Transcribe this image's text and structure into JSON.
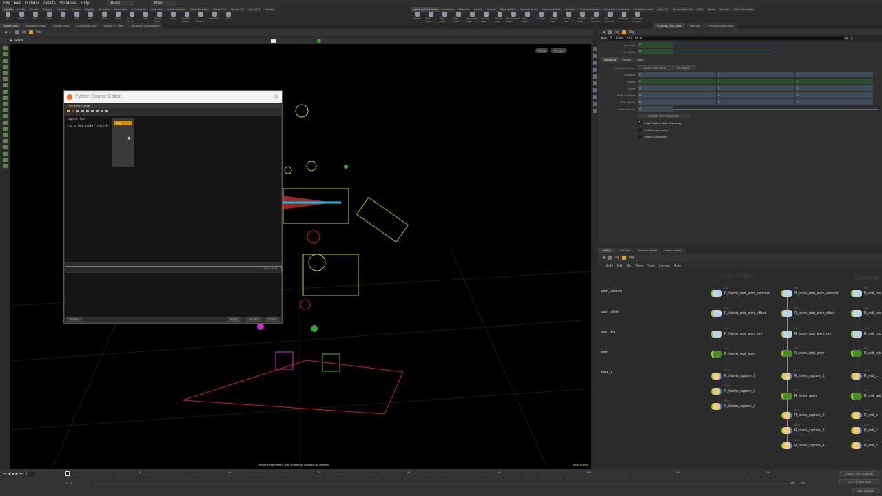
{
  "menu": {
    "items": [
      "File",
      "Edit",
      "Render",
      "Assets",
      "Windows",
      "Help"
    ],
    "desktop": "Build",
    "context": "Main"
  },
  "shelf_left": {
    "tabs": [
      "Create",
      "Modify",
      "Model",
      "Polygon",
      "Deform",
      "Texture",
      "Rigging",
      "Muscles",
      "Characters",
      "Constraints",
      "Hair Utils",
      "Guide Process",
      "Guide Brushes",
      "Terrain FX",
      "Simple FX",
      "Cloud FX",
      "Volume"
    ],
    "tools": [
      "Box",
      "Sphere",
      "Tube",
      "Torus",
      "Grid",
      "Null",
      "Line",
      "Circle",
      "Curve",
      "Draw Curve",
      "Path",
      "Spray Paint",
      "Font",
      "Platonic Solids",
      "L-System",
      "Metaball",
      "File"
    ]
  },
  "shelf_right": {
    "tabs": [
      "Lights and Cameras",
      "Collisions",
      "Particles",
      "Grains",
      "Vellum",
      "Rigid Bodies",
      "Particle Fluids",
      "Viscous Fluids",
      "Oceans",
      "Fluid Containers",
      "Populate Containers",
      "Container Tools",
      "Pyro FX",
      "Sparse Pyro FX",
      "FEM",
      "Wires",
      "Crowds",
      "Drive Simulation"
    ],
    "tools": [
      "Camera",
      "Point Light",
      "Spot Light",
      "Area Light",
      "Geometry Light",
      "Volume Light",
      "Distant Light",
      "Environment Light",
      "Sky Light",
      "GI Light",
      "Caustic Light",
      "Portal Light",
      "Ambient Light",
      "Stereo Camera",
      "VR Camera",
      "Switcher",
      "Gamepad Camera"
    ]
  },
  "pane_tabs_left": [
    "Scene View",
    "Animation Editor",
    "Render View",
    "Composite View",
    "Motion FX View",
    "Geometry Spreadsheet"
  ],
  "pane_tabs_right": [
    "R_thumb_root_anim",
    "Take List",
    "Performance Monitor"
  ],
  "path": {
    "root": "obj",
    "node": "Rig"
  },
  "viewport": {
    "tool": "Select",
    "persp": "Persp",
    "cam": "No cam",
    "status": "Select the geometry, then choose an operation to perform.",
    "edition": "Indie Edition"
  },
  "pse": {
    "title": "Python Source Editor",
    "module": "hou.session module",
    "code_line1": "import hou",
    "code_line2": "rig = hou.node(\"/obj/R",
    "popup_item": "Rig",
    "cursor_pos": "Ln 3, Col 23",
    "buttons": {
      "reload": "Reload",
      "apply": "Apply",
      "accept": "Accept",
      "close": "Close"
    }
  },
  "params": {
    "node_type": "Null",
    "node_name": "R_thumb_root_anim",
    "bend": [
      {
        "label": "Bend Mid",
        "value": "0"
      },
      {
        "label": "Bend End",
        "value": "0"
      }
    ],
    "tabs": [
      "Transform",
      "Render",
      "Misc"
    ],
    "transform_order_label": "Transform Order",
    "transform_order": "Scale Rot Trans",
    "rotate_order": "Rx Ry Rz",
    "rows": [
      {
        "label": "Translate",
        "values": [
          "0",
          "0",
          "0"
        ]
      },
      {
        "label": "Rotate",
        "values": [
          "0",
          "0",
          "0"
        ]
      },
      {
        "label": "Scale",
        "values": [
          "1",
          "1",
          "1"
        ]
      },
      {
        "label": "Pivot Translate",
        "values": [
          "0",
          "0",
          "0"
        ]
      },
      {
        "label": "Pivot Rotate",
        "values": [
          "0",
          "0",
          "0"
        ]
      }
    ],
    "uniform_scale_label": "Uniform Scale",
    "uniform_scale": "1",
    "modify_pre": "Modify Pre-Transform",
    "checks": [
      {
        "label": "Keep Position When Parenting",
        "checked": true
      },
      {
        "label": "Child Compensation",
        "checked": false
      },
      {
        "label": "Enable Constraints",
        "checked": false
      }
    ]
  },
  "network": {
    "tabs": [
      "/obj/Rig",
      "Tree View",
      "Material Palette",
      "Asset Browser"
    ],
    "menu": [
      "Add",
      "Edit",
      "Go",
      "View",
      "Tools",
      "Layout",
      "Help"
    ],
    "watermark1": "Indie Edition",
    "watermark2": "Objects",
    "left_labels": [
      "anim_connect",
      "anim_offset",
      "anim_drv",
      "anim",
      "bone_1"
    ],
    "thumb": [
      {
        "t": "Null",
        "n": "R_thumb_root_anim_connect"
      },
      {
        "t": "Null",
        "n": "R_thumb_root_anim_offset"
      },
      {
        "t": "Null",
        "n": "R_thumb_root_anim_drv"
      },
      {
        "t": "Null",
        "n": "R_thumb_root_anim"
      },
      {
        "t": "Bone",
        "n": "R_thumb_capture_1"
      },
      {
        "t": "Bone",
        "n": "R_thumb_capture_2"
      },
      {
        "t": "Bone",
        "n": "R_thumb_capture_3"
      }
    ],
    "index": [
      {
        "t": "Null",
        "n": "R_index_root_anim_connect"
      },
      {
        "t": "Null",
        "n": "R_index_root_anim_offset"
      },
      {
        "t": "Null",
        "n": "R_index_root_anim_drv"
      },
      {
        "t": "Null",
        "n": "R_index_root_anim"
      },
      {
        "t": "Bone",
        "n": "R_index_capture_1"
      },
      {
        "t": "Null",
        "n": "R_index_anim"
      },
      {
        "t": "Bone",
        "n": "R_index_capture_2"
      },
      {
        "t": "Bone",
        "n": "R_index_capture_3"
      },
      {
        "t": "Bone",
        "n": "R_index_capture_4"
      }
    ],
    "mid": [
      {
        "t": "Null",
        "n": "R_mid_roo"
      },
      {
        "t": "Null",
        "n": "R_mid_roo"
      },
      {
        "t": "Null",
        "n": "R_mid_roo"
      },
      {
        "t": "Null",
        "n": "R_mid_roo"
      },
      {
        "t": "Bone",
        "n": "R_mid_c"
      },
      {
        "t": "Null",
        "n": "R_mid_ani"
      },
      {
        "t": "Bone",
        "n": "R_mid_c"
      },
      {
        "t": "Bone",
        "n": "R_mid_c"
      },
      {
        "t": "Bone",
        "n": "R_mid_c"
      }
    ]
  },
  "timeline": {
    "frame": "1",
    "start": "1",
    "start2": "1",
    "end": "240",
    "end2": "240",
    "ticks": [
      "24",
      "48",
      "72",
      "96",
      "144",
      "168",
      "192",
      "216",
      "24"
    ],
    "keys": "0 keys, 0/0 channels",
    "key_all": "Key All Channels",
    "auto_update": "Auto Update"
  }
}
